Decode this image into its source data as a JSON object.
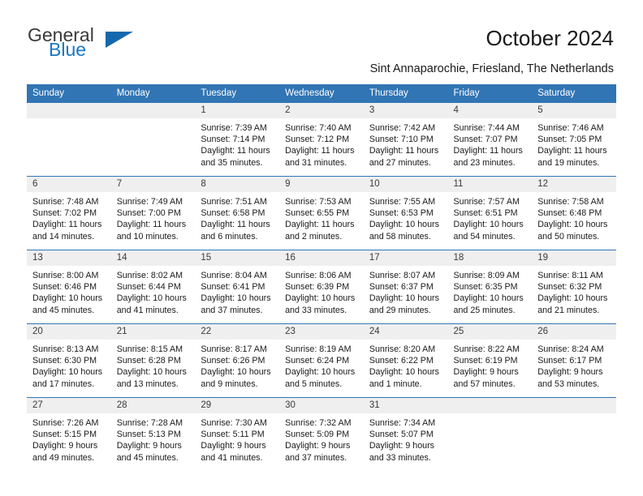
{
  "brand": {
    "name_line1": "General",
    "name_line2": "Blue",
    "color_dark": "#3a3a3a",
    "color_blue": "#1877c4"
  },
  "header": {
    "title": "October 2024",
    "subtitle": "Sint Annaparochie, Friesland, The Netherlands",
    "accent_color": "#3175b4"
  },
  "calendar": {
    "weekday_headers": [
      "Sunday",
      "Monday",
      "Tuesday",
      "Wednesday",
      "Thursday",
      "Friday",
      "Saturday"
    ],
    "weeks": [
      [
        {
          "day": "",
          "sunrise": "",
          "sunset": "",
          "daylight": "",
          "empty": true
        },
        {
          "day": "",
          "sunrise": "",
          "sunset": "",
          "daylight": "",
          "empty": true
        },
        {
          "day": "1",
          "sunrise": "Sunrise: 7:39 AM",
          "sunset": "Sunset: 7:14 PM",
          "daylight": "Daylight: 11 hours and 35 minutes."
        },
        {
          "day": "2",
          "sunrise": "Sunrise: 7:40 AM",
          "sunset": "Sunset: 7:12 PM",
          "daylight": "Daylight: 11 hours and 31 minutes."
        },
        {
          "day": "3",
          "sunrise": "Sunrise: 7:42 AM",
          "sunset": "Sunset: 7:10 PM",
          "daylight": "Daylight: 11 hours and 27 minutes."
        },
        {
          "day": "4",
          "sunrise": "Sunrise: 7:44 AM",
          "sunset": "Sunset: 7:07 PM",
          "daylight": "Daylight: 11 hours and 23 minutes."
        },
        {
          "day": "5",
          "sunrise": "Sunrise: 7:46 AM",
          "sunset": "Sunset: 7:05 PM",
          "daylight": "Daylight: 11 hours and 19 minutes."
        }
      ],
      [
        {
          "day": "6",
          "sunrise": "Sunrise: 7:48 AM",
          "sunset": "Sunset: 7:02 PM",
          "daylight": "Daylight: 11 hours and 14 minutes."
        },
        {
          "day": "7",
          "sunrise": "Sunrise: 7:49 AM",
          "sunset": "Sunset: 7:00 PM",
          "daylight": "Daylight: 11 hours and 10 minutes."
        },
        {
          "day": "8",
          "sunrise": "Sunrise: 7:51 AM",
          "sunset": "Sunset: 6:58 PM",
          "daylight": "Daylight: 11 hours and 6 minutes."
        },
        {
          "day": "9",
          "sunrise": "Sunrise: 7:53 AM",
          "sunset": "Sunset: 6:55 PM",
          "daylight": "Daylight: 11 hours and 2 minutes."
        },
        {
          "day": "10",
          "sunrise": "Sunrise: 7:55 AM",
          "sunset": "Sunset: 6:53 PM",
          "daylight": "Daylight: 10 hours and 58 minutes."
        },
        {
          "day": "11",
          "sunrise": "Sunrise: 7:57 AM",
          "sunset": "Sunset: 6:51 PM",
          "daylight": "Daylight: 10 hours and 54 minutes."
        },
        {
          "day": "12",
          "sunrise": "Sunrise: 7:58 AM",
          "sunset": "Sunset: 6:48 PM",
          "daylight": "Daylight: 10 hours and 50 minutes."
        }
      ],
      [
        {
          "day": "13",
          "sunrise": "Sunrise: 8:00 AM",
          "sunset": "Sunset: 6:46 PM",
          "daylight": "Daylight: 10 hours and 45 minutes."
        },
        {
          "day": "14",
          "sunrise": "Sunrise: 8:02 AM",
          "sunset": "Sunset: 6:44 PM",
          "daylight": "Daylight: 10 hours and 41 minutes."
        },
        {
          "day": "15",
          "sunrise": "Sunrise: 8:04 AM",
          "sunset": "Sunset: 6:41 PM",
          "daylight": "Daylight: 10 hours and 37 minutes."
        },
        {
          "day": "16",
          "sunrise": "Sunrise: 8:06 AM",
          "sunset": "Sunset: 6:39 PM",
          "daylight": "Daylight: 10 hours and 33 minutes."
        },
        {
          "day": "17",
          "sunrise": "Sunrise: 8:07 AM",
          "sunset": "Sunset: 6:37 PM",
          "daylight": "Daylight: 10 hours and 29 minutes."
        },
        {
          "day": "18",
          "sunrise": "Sunrise: 8:09 AM",
          "sunset": "Sunset: 6:35 PM",
          "daylight": "Daylight: 10 hours and 25 minutes."
        },
        {
          "day": "19",
          "sunrise": "Sunrise: 8:11 AM",
          "sunset": "Sunset: 6:32 PM",
          "daylight": "Daylight: 10 hours and 21 minutes."
        }
      ],
      [
        {
          "day": "20",
          "sunrise": "Sunrise: 8:13 AM",
          "sunset": "Sunset: 6:30 PM",
          "daylight": "Daylight: 10 hours and 17 minutes."
        },
        {
          "day": "21",
          "sunrise": "Sunrise: 8:15 AM",
          "sunset": "Sunset: 6:28 PM",
          "daylight": "Daylight: 10 hours and 13 minutes."
        },
        {
          "day": "22",
          "sunrise": "Sunrise: 8:17 AM",
          "sunset": "Sunset: 6:26 PM",
          "daylight": "Daylight: 10 hours and 9 minutes."
        },
        {
          "day": "23",
          "sunrise": "Sunrise: 8:19 AM",
          "sunset": "Sunset: 6:24 PM",
          "daylight": "Daylight: 10 hours and 5 minutes."
        },
        {
          "day": "24",
          "sunrise": "Sunrise: 8:20 AM",
          "sunset": "Sunset: 6:22 PM",
          "daylight": "Daylight: 10 hours and 1 minute."
        },
        {
          "day": "25",
          "sunrise": "Sunrise: 8:22 AM",
          "sunset": "Sunset: 6:19 PM",
          "daylight": "Daylight: 9 hours and 57 minutes."
        },
        {
          "day": "26",
          "sunrise": "Sunrise: 8:24 AM",
          "sunset": "Sunset: 6:17 PM",
          "daylight": "Daylight: 9 hours and 53 minutes."
        }
      ],
      [
        {
          "day": "27",
          "sunrise": "Sunrise: 7:26 AM",
          "sunset": "Sunset: 5:15 PM",
          "daylight": "Daylight: 9 hours and 49 minutes."
        },
        {
          "day": "28",
          "sunrise": "Sunrise: 7:28 AM",
          "sunset": "Sunset: 5:13 PM",
          "daylight": "Daylight: 9 hours and 45 minutes."
        },
        {
          "day": "29",
          "sunrise": "Sunrise: 7:30 AM",
          "sunset": "Sunset: 5:11 PM",
          "daylight": "Daylight: 9 hours and 41 minutes."
        },
        {
          "day": "30",
          "sunrise": "Sunrise: 7:32 AM",
          "sunset": "Sunset: 5:09 PM",
          "daylight": "Daylight: 9 hours and 37 minutes."
        },
        {
          "day": "31",
          "sunrise": "Sunrise: 7:34 AM",
          "sunset": "Sunset: 5:07 PM",
          "daylight": "Daylight: 9 hours and 33 minutes."
        },
        {
          "day": "",
          "sunrise": "",
          "sunset": "",
          "daylight": "",
          "empty": true
        },
        {
          "day": "",
          "sunrise": "",
          "sunset": "",
          "daylight": "",
          "empty": true
        }
      ]
    ]
  }
}
